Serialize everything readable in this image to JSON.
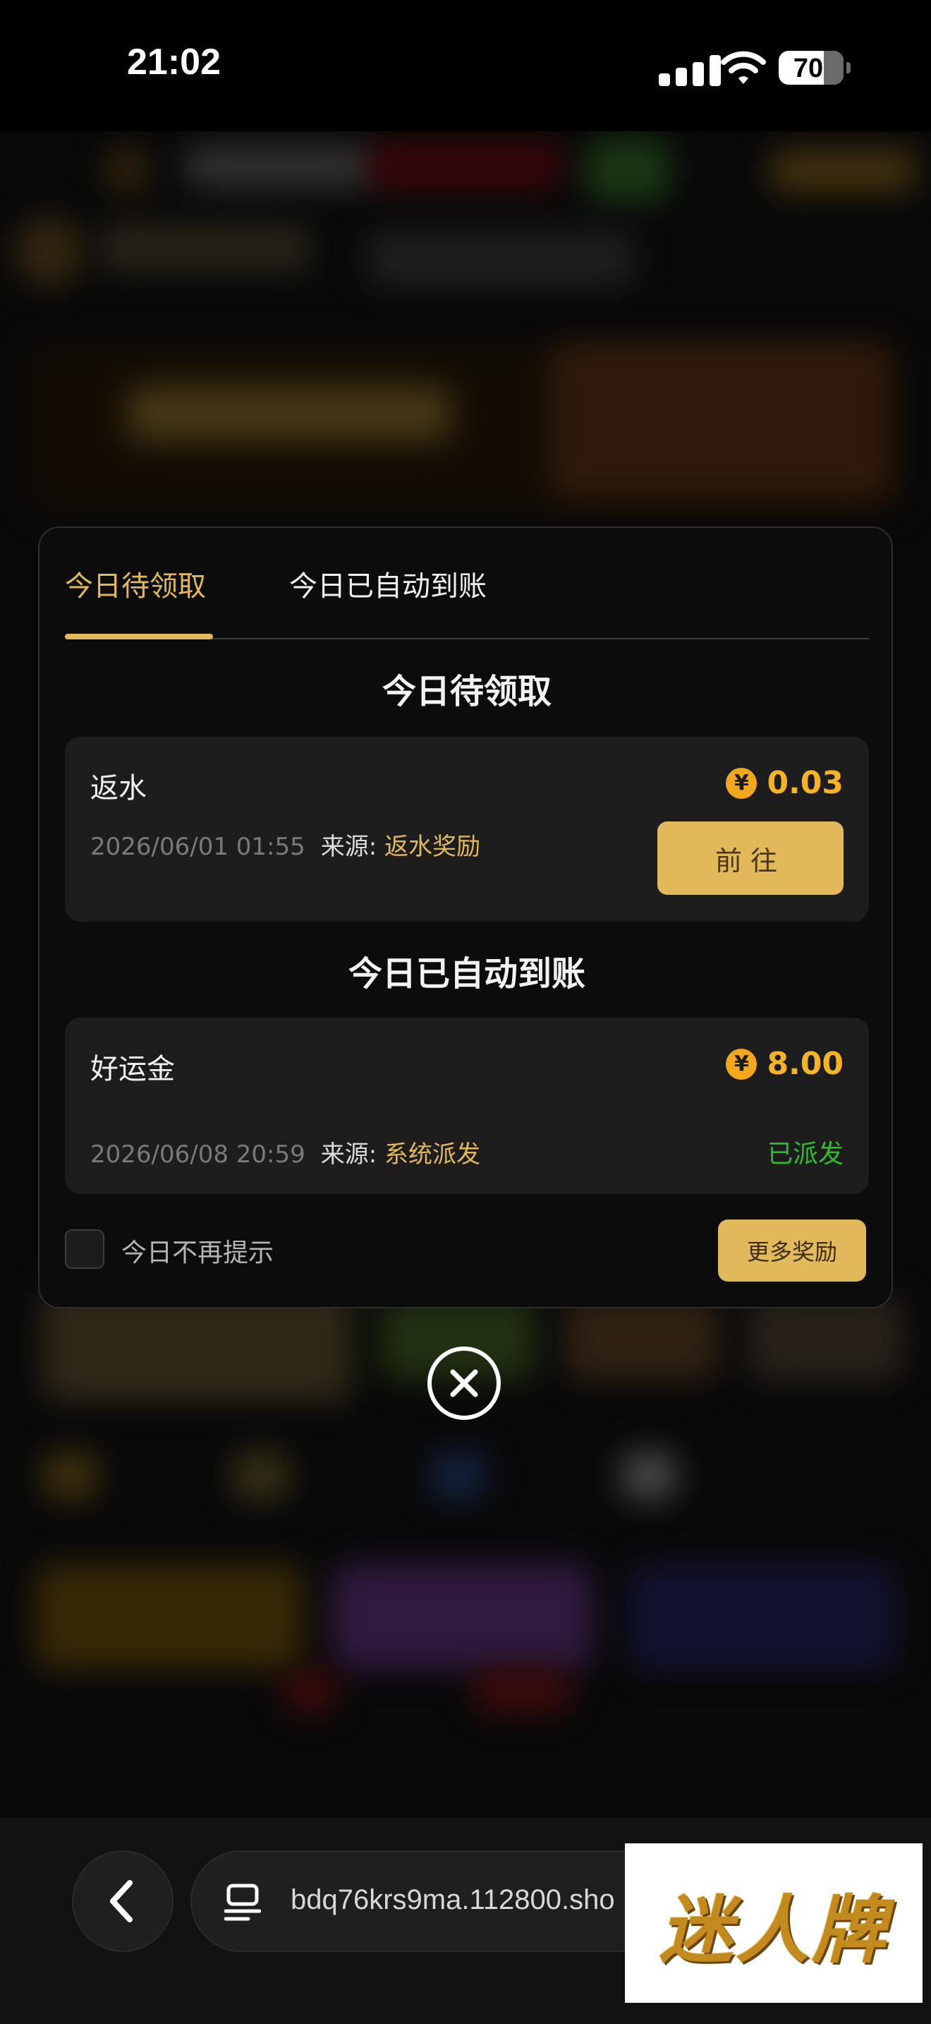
{
  "status_bar": {
    "time": "21:02",
    "battery": "70",
    "battery_level_percent": 70
  },
  "modal": {
    "tabs": [
      {
        "label": "今日待领取",
        "active": true
      },
      {
        "label": "今日已自动到账",
        "active": false
      }
    ],
    "pending_section": {
      "title": "今日待领取",
      "item": {
        "name": "返水",
        "amount": "0.03",
        "currency_icon": "¥",
        "date": "2026/06/01 01:55",
        "source_label": "来源:",
        "source_value": "返水奖励",
        "action_label": "前往"
      }
    },
    "auto_section": {
      "title": "今日已自动到账",
      "item": {
        "name": "好运金",
        "amount": "8.00",
        "currency_icon": "¥",
        "date": "2026/06/08 20:59",
        "source_label": "来源:",
        "source_value": "系统派发",
        "status": "已派发"
      }
    },
    "footer": {
      "checkbox_label": "今日不再提示",
      "checked": false,
      "more_button": "更多奖励"
    }
  },
  "browser": {
    "url": "bdq76krs9ma.112800.sho",
    "watermark": "迷人牌"
  },
  "colors": {
    "accent_gold": "#e2b95a",
    "amount_orange": "#f6b324",
    "success_green": "#2bbd2b"
  }
}
